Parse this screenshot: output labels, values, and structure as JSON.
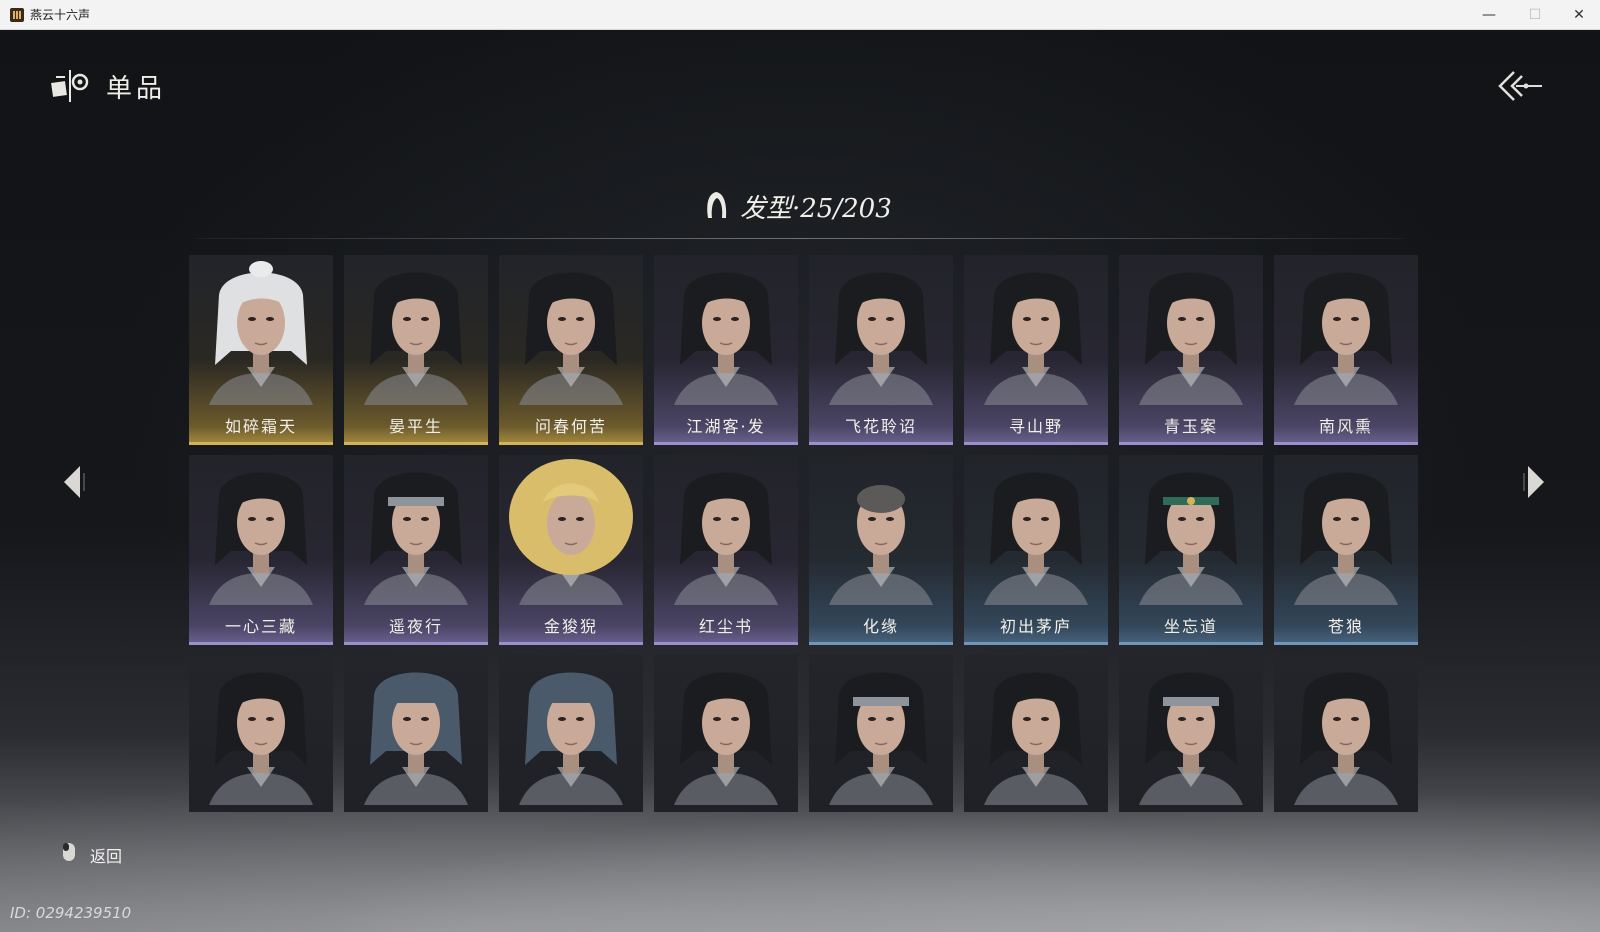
{
  "window": {
    "title": "燕云十六声",
    "min": "—",
    "max": "☐",
    "close": "✕"
  },
  "header": {
    "title": "单品"
  },
  "section": {
    "title": "发型·25/203"
  },
  "colors": {
    "gold": "#d2b35a",
    "purple": "#9c8fce",
    "blue": "#6f97bd"
  },
  "cards": [
    {
      "label": "如碎霜天",
      "tier": "gold",
      "hair": "white"
    },
    {
      "label": "晏平生",
      "tier": "gold",
      "hair": "dark"
    },
    {
      "label": "问春何苦",
      "tier": "gold",
      "hair": "dark"
    },
    {
      "label": "江湖客·发",
      "tier": "purple",
      "hair": "dark"
    },
    {
      "label": "飞花聆诏",
      "tier": "purple",
      "hair": "dark"
    },
    {
      "label": "寻山野",
      "tier": "purple",
      "hair": "dark"
    },
    {
      "label": "青玉案",
      "tier": "purple",
      "hair": "dark"
    },
    {
      "label": "南风熏",
      "tier": "purple",
      "hair": "dark"
    },
    {
      "label": "一心三藏",
      "tier": "purple",
      "hair": "dark"
    },
    {
      "label": "遥夜行",
      "tier": "purple",
      "hair": "headband"
    },
    {
      "label": "金狻猊",
      "tier": "purple",
      "hair": "blonde"
    },
    {
      "label": "红尘书",
      "tier": "purple",
      "hair": "dark"
    },
    {
      "label": "化缘",
      "tier": "blue",
      "hair": "bald"
    },
    {
      "label": "初出茅庐",
      "tier": "blue",
      "hair": "dark"
    },
    {
      "label": "坐忘道",
      "tier": "blue",
      "hair": "greenband"
    },
    {
      "label": "苍狼",
      "tier": "blue",
      "hair": "dark"
    },
    {
      "label": "",
      "tier": "plain",
      "hair": "dark"
    },
    {
      "label": "",
      "tier": "plain",
      "hair": "cap"
    },
    {
      "label": "",
      "tier": "plain",
      "hair": "cap"
    },
    {
      "label": "",
      "tier": "plain",
      "hair": "dark"
    },
    {
      "label": "",
      "tier": "plain",
      "hair": "headband"
    },
    {
      "label": "",
      "tier": "plain",
      "hair": "dark"
    },
    {
      "label": "",
      "tier": "plain",
      "hair": "headband"
    },
    {
      "label": "",
      "tier": "plain",
      "hair": "dark"
    }
  ],
  "footer": {
    "back_label": "返回",
    "player_id": "ID: 0294239510"
  }
}
